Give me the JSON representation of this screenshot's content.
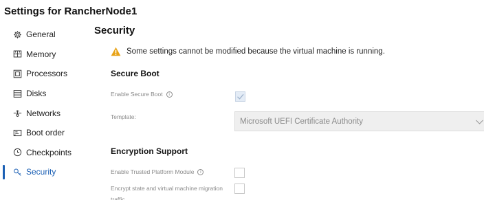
{
  "window": {
    "title": "Settings for RancherNode1"
  },
  "sidebar": {
    "items": [
      {
        "label": "General",
        "icon": "gear-icon",
        "active": false
      },
      {
        "label": "Memory",
        "icon": "memory-icon",
        "active": false
      },
      {
        "label": "Processors",
        "icon": "processor-icon",
        "active": false
      },
      {
        "label": "Disks",
        "icon": "disk-icon",
        "active": false
      },
      {
        "label": "Networks",
        "icon": "network-icon",
        "active": false
      },
      {
        "label": "Boot order",
        "icon": "boot-order-icon",
        "active": false
      },
      {
        "label": "Checkpoints",
        "icon": "checkpoint-icon",
        "active": false
      },
      {
        "label": "Security",
        "icon": "security-icon",
        "active": true
      }
    ]
  },
  "main": {
    "title": "Security",
    "warning": "Some settings cannot be modified because the virtual machine is running.",
    "secure_boot": {
      "heading": "Secure Boot",
      "enable_label": "Enable Secure Boot",
      "enable_checked": true,
      "template_label": "Template:",
      "template_value": "Microsoft UEFI Certificate Authority"
    },
    "encryption": {
      "heading": "Encryption Support",
      "tpm_label": "Enable Trusted Platform Module",
      "tpm_checked": false,
      "encrypt_label_line1": "Encrypt state and virtual machine migration",
      "encrypt_label_line2": "traffic",
      "encrypt_checked": false
    }
  },
  "colors": {
    "accent": "#1a5fb4",
    "warning": "#e8a317",
    "disabled_text": "#8a8a8a"
  }
}
